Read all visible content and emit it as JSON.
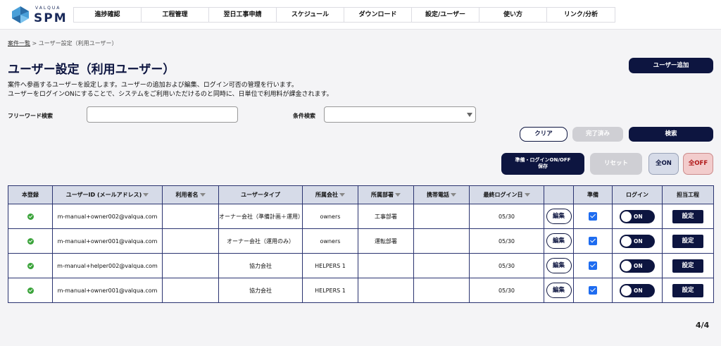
{
  "brand": {
    "small": "VALQUA",
    "big": "SPM"
  },
  "nav": [
    "進捗確認",
    "工程管理",
    "翌日工事申請",
    "スケジュール",
    "ダウンロード",
    "設定/ユーザー",
    "使い方",
    "リンク/分析"
  ],
  "breadcrumb": {
    "link": "案件一覧",
    "separator": " > ",
    "current": "ユーザー設定（利用ユーザー）"
  },
  "page": {
    "title": "ユーザー設定（利用ユーザー）",
    "desc1": "案件へ参画するユーザーを設定します。ユーザーの追加および編集、ログイン可否の管理を行います。",
    "desc2": "ユーザーをログインONにすることで、システムをご利用いただけるのと同時に、日単位で利用料が課金されます。"
  },
  "buttons": {
    "add_user": "ユーザー追加",
    "clear": "クリア",
    "done": "完了済み",
    "search": "検索",
    "save_line1": "準備・ログインON/OFF",
    "save_line2": "保存",
    "reset": "リセット",
    "all_on": "全ON",
    "all_off": "全OFF"
  },
  "search": {
    "free_label": "フリーワード検索",
    "free_value": "",
    "cond_label": "条件検索",
    "cond_value": ""
  },
  "table": {
    "headers": [
      "本登録",
      "ユーザーID (メールアドレス)",
      "利用者名",
      "ユーザータイプ",
      "所属会社",
      "所属部署",
      "携帯電話",
      "最終ログイン日",
      "",
      "準備",
      "ログイン",
      "担当工程"
    ],
    "edit_label": "編集",
    "toggle_label": "ON",
    "set_label": "設定",
    "rows": [
      {
        "email": "m-manual+owner002@valqua.com",
        "name": "",
        "type": "オーナー会社（準備計画＋運用）",
        "company": "owners",
        "dept": "工事部署",
        "phone": "",
        "last_login": "05/30"
      },
      {
        "email": "m-manual+owner001@valqua.com",
        "name": "",
        "type": "オーナー会社（運用のみ）",
        "company": "owners",
        "dept": "運転部署",
        "phone": "",
        "last_login": "05/30"
      },
      {
        "email": "m-manual+helper002@valqua.com",
        "name": "",
        "type": "協力会社",
        "company": "HELPERS 1",
        "dept": "",
        "phone": "",
        "last_login": "05/30"
      },
      {
        "email": "m-manual+owner001@valqua.com",
        "name": "",
        "type": "協力会社",
        "company": "HELPERS 1",
        "dept": "",
        "phone": "",
        "last_login": "05/30"
      }
    ]
  },
  "pagination": "4/4",
  "colors": {
    "primary": "#0d1540",
    "header_bg": "#d6dbe8",
    "check_green": "#3aa33a",
    "checkbox_blue": "#1e6cf0"
  }
}
